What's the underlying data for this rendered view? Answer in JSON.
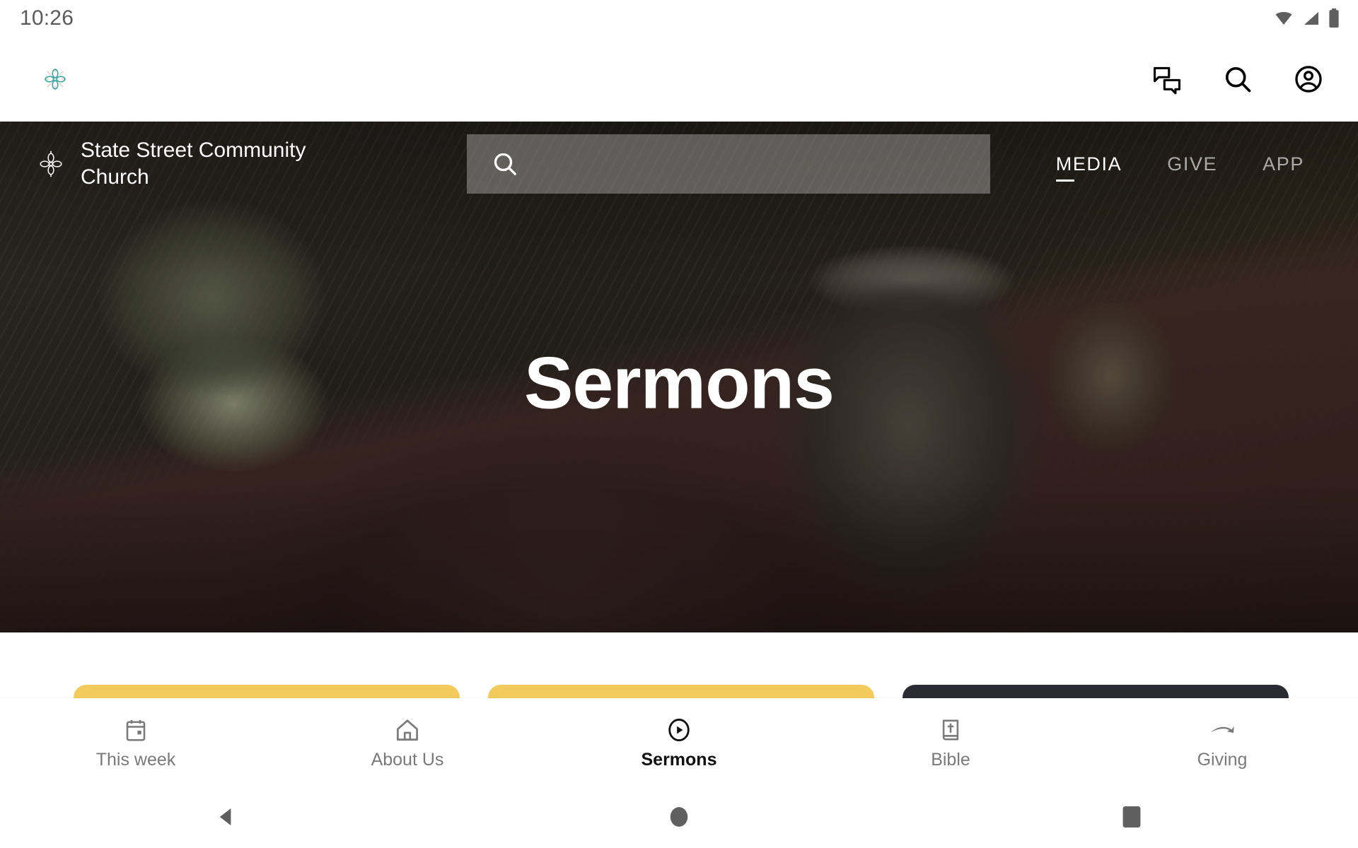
{
  "status_bar": {
    "clock": "10:26",
    "icons": [
      "wifi-icon",
      "cellular-signal-icon",
      "battery-icon"
    ],
    "text_color": "#5b5b5b"
  },
  "app_bar": {
    "brand_logo": "church-quatrefoil-logo",
    "logo_color": "#3FA7A0",
    "actions": [
      {
        "name": "messages-icon",
        "label": "Messages"
      },
      {
        "name": "search-icon",
        "label": "Search"
      },
      {
        "name": "account-icon",
        "label": "Account"
      }
    ]
  },
  "hero": {
    "brand_name": "State Street Community Church",
    "brand_logo": "church-quatrefoil-logo",
    "title": "Sermons",
    "search": {
      "value": "",
      "placeholder": "",
      "icon": "search-icon"
    },
    "nav": [
      {
        "label": "MEDIA",
        "active": true
      },
      {
        "label": "GIVE",
        "active": false
      },
      {
        "label": "APP",
        "active": false
      }
    ],
    "background_description": "dark photo of a glass of herbs, leather bible and coffee mug on a wooden table"
  },
  "content": {
    "cards": [
      {
        "name": "sermon-card-1",
        "tone": "gold",
        "color": "#F2CB5C"
      },
      {
        "name": "sermon-card-2",
        "tone": "gold",
        "color": "#F2CB5C"
      },
      {
        "name": "sermon-card-3",
        "tone": "dark",
        "color": "#2B2B33"
      }
    ]
  },
  "bottom_nav": {
    "items": [
      {
        "label": "This week",
        "icon": "calendar-icon",
        "active": false
      },
      {
        "label": "About Us",
        "icon": "home-icon",
        "active": false
      },
      {
        "label": "Sermons",
        "icon": "play-circle-icon",
        "active": true
      },
      {
        "label": "Bible",
        "icon": "bible-book-icon",
        "active": false
      },
      {
        "label": "Giving",
        "icon": "giving-hand-icon",
        "active": false
      }
    ],
    "active_color": "#101010",
    "inactive_color": "#7A7A7A"
  },
  "system_nav": {
    "buttons": [
      {
        "name": "back-button",
        "icon": "triangle-back-icon"
      },
      {
        "name": "home-button",
        "icon": "circle-home-icon"
      },
      {
        "name": "recents-button",
        "icon": "square-recents-icon"
      }
    ],
    "color": "#5f5f5f"
  }
}
